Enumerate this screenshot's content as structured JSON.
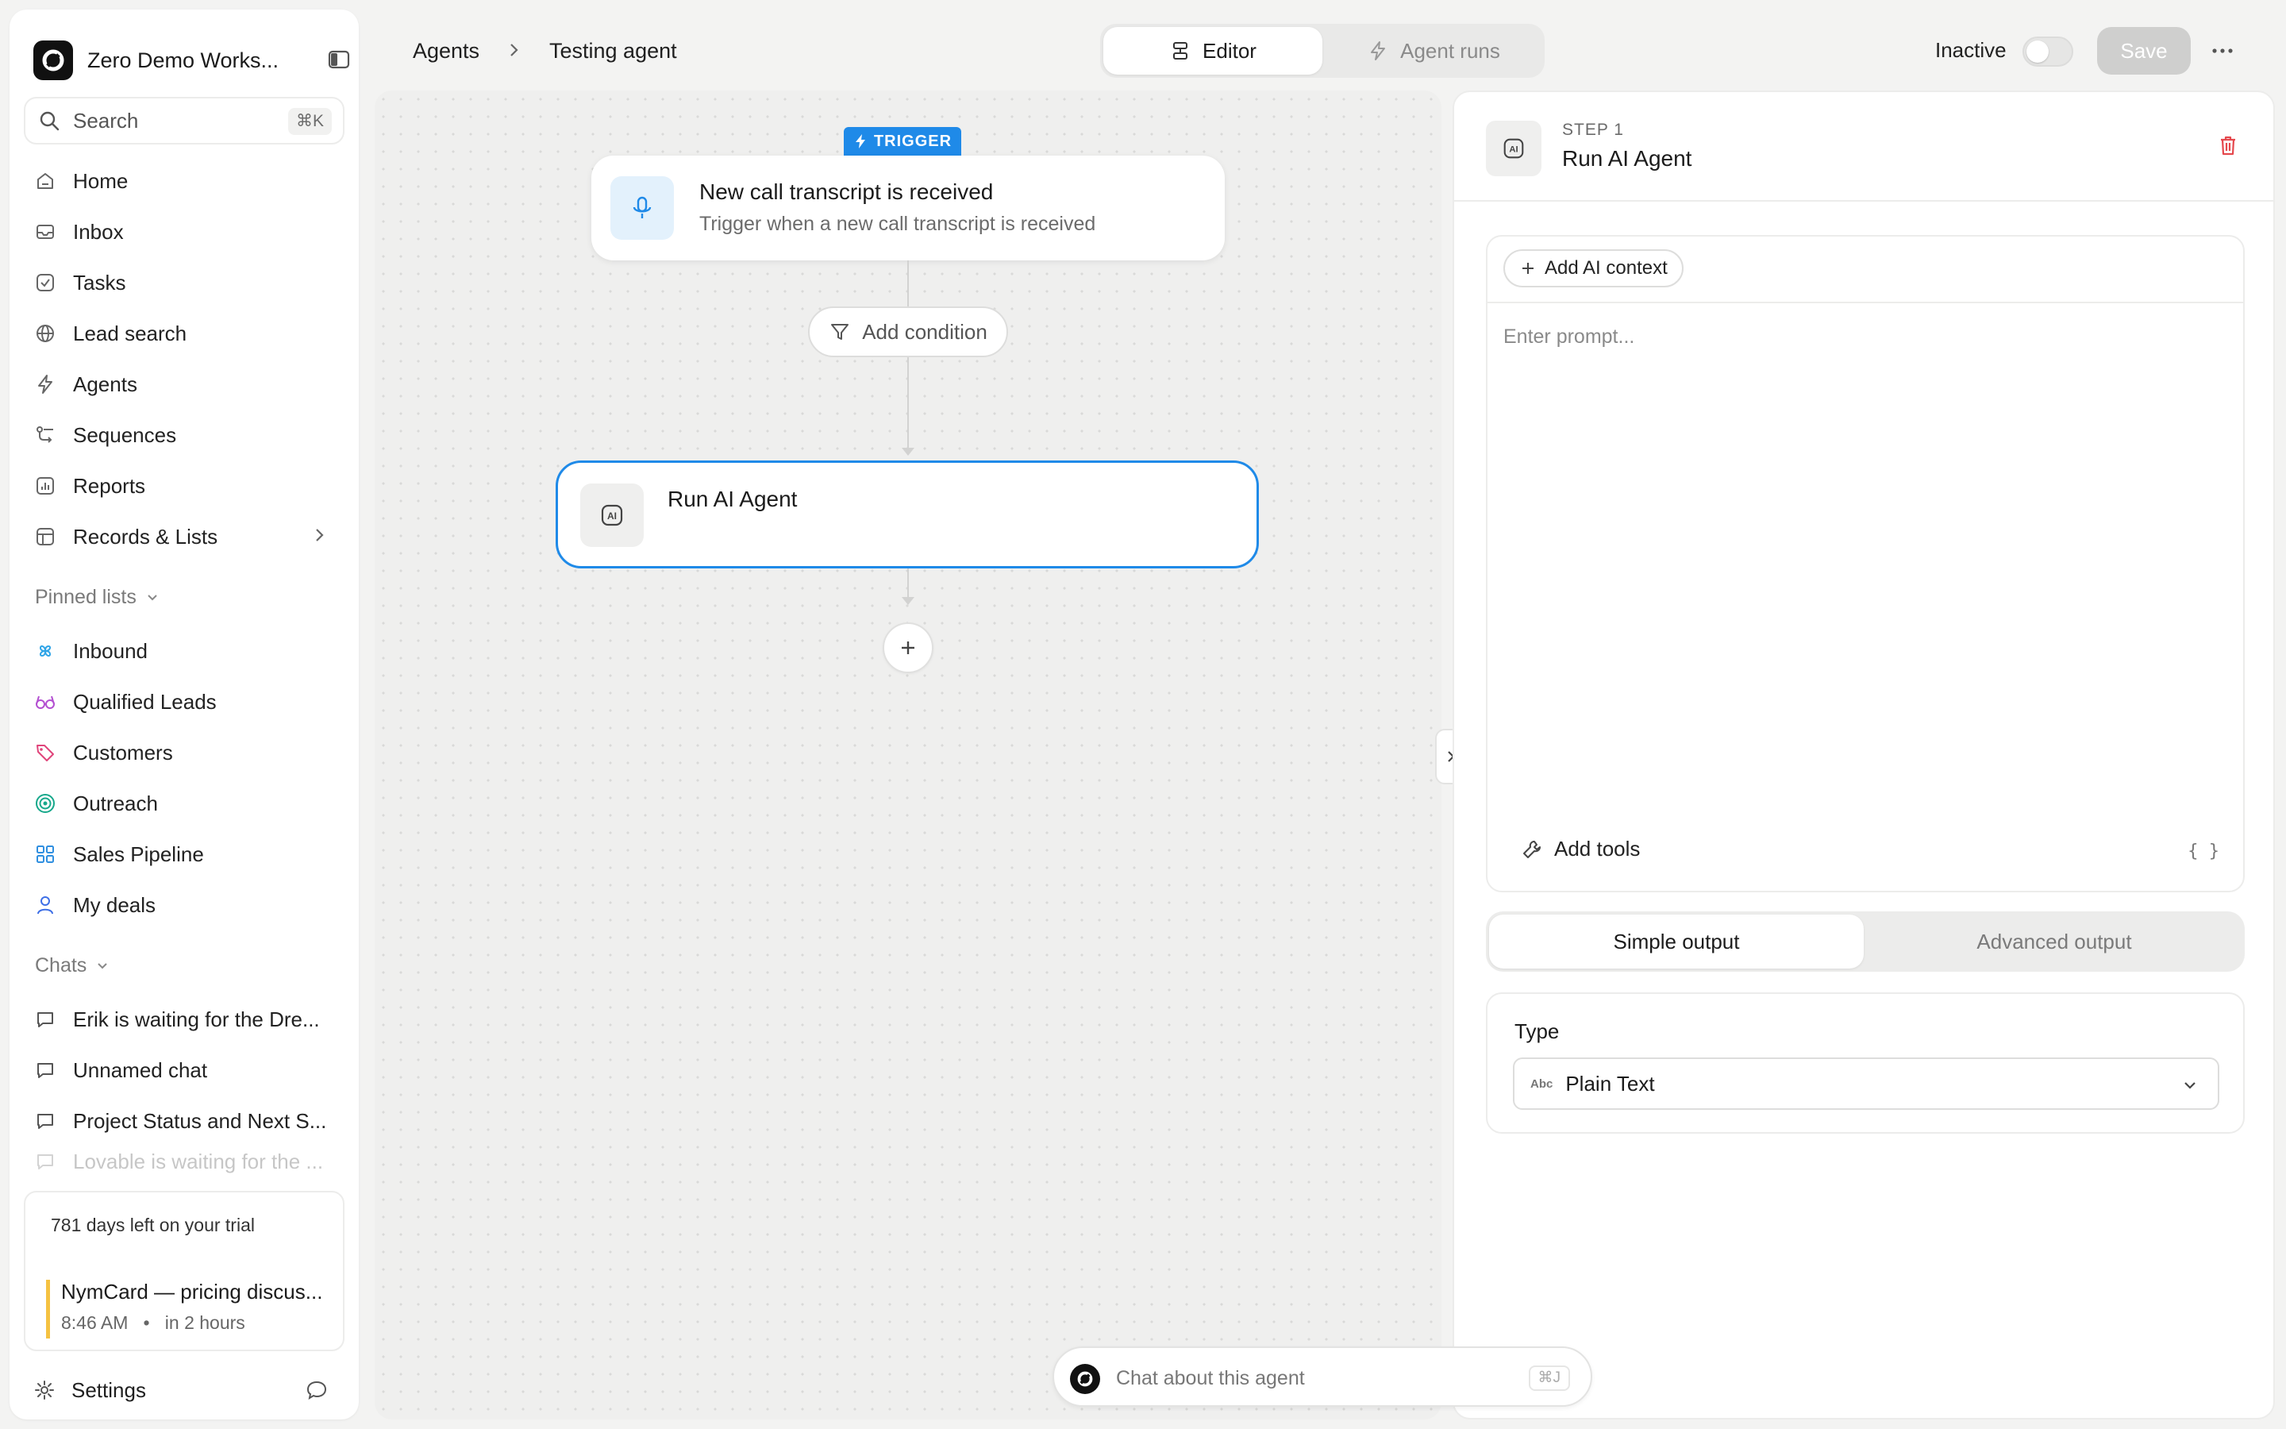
{
  "workspace": {
    "name": "Zero Demo Works..."
  },
  "search": {
    "placeholder": "Search",
    "shortcut": "⌘K"
  },
  "nav": [
    {
      "label": "Home",
      "icon": "home-icon"
    },
    {
      "label": "Inbox",
      "icon": "inbox-icon"
    },
    {
      "label": "Tasks",
      "icon": "tasks-icon"
    },
    {
      "label": "Lead search",
      "icon": "globe-icon"
    },
    {
      "label": "Agents",
      "icon": "lightning-icon"
    },
    {
      "label": "Sequences",
      "icon": "sequences-icon"
    },
    {
      "label": "Reports",
      "icon": "reports-icon"
    },
    {
      "label": "Records & Lists",
      "icon": "table-icon"
    }
  ],
  "pinned": {
    "heading": "Pinned lists",
    "items": [
      {
        "label": "Inbound",
        "color": "#2fa4e7",
        "icon": "pinwheel-icon"
      },
      {
        "label": "Qualified Leads",
        "color": "#b34fd1",
        "icon": "glasses-icon"
      },
      {
        "label": "Customers",
        "color": "#e0457b",
        "icon": "tag-icon"
      },
      {
        "label": "Outreach",
        "color": "#17a88b",
        "icon": "target-icon"
      },
      {
        "label": "Sales Pipeline",
        "color": "#2f8fe0",
        "icon": "grid-icon"
      },
      {
        "label": "My deals",
        "color": "#3e6fe6",
        "icon": "person-icon"
      }
    ]
  },
  "chats": {
    "heading": "Chats",
    "items": [
      {
        "label": "Erik is waiting for the Dre..."
      },
      {
        "label": "Unnamed chat"
      },
      {
        "label": "Project Status and Next S..."
      },
      {
        "label": "Lovable is waiting for the ..."
      }
    ]
  },
  "trial": {
    "text": "781 days left on your trial",
    "meeting_title": "NymCard — pricing discus...",
    "meeting_time": "8:46 AM",
    "meeting_when": "in 2 hours",
    "accent": "#f5c242"
  },
  "settings": {
    "label": "Settings"
  },
  "breadcrumb": {
    "root": "Agents",
    "current": "Testing agent"
  },
  "tabs": {
    "editor": "Editor",
    "runs": "Agent runs"
  },
  "status": {
    "label": "Inactive",
    "enabled": false
  },
  "save": {
    "label": "Save"
  },
  "canvas": {
    "trigger_badge": "TRIGGER",
    "trigger_title": "New call transcript is received",
    "trigger_subtitle": "Trigger when a new call transcript is received",
    "condition_label": "Add condition",
    "step_title": "Run AI Agent",
    "accent": "#1f8ae8"
  },
  "chat_bar": {
    "placeholder": "Chat about this agent",
    "shortcut": "⌘J"
  },
  "panel": {
    "step_label": "STEP 1",
    "step_title": "Run AI Agent",
    "add_context": "Add AI context",
    "prompt_placeholder": "Enter prompt...",
    "add_tools": "Add tools",
    "braces": "{ }",
    "output_simple": "Simple output",
    "output_advanced": "Advanced output",
    "type_label": "Type",
    "type_value": "Plain Text",
    "type_icon_text": "Abc",
    "delete_color": "#e5484d"
  }
}
